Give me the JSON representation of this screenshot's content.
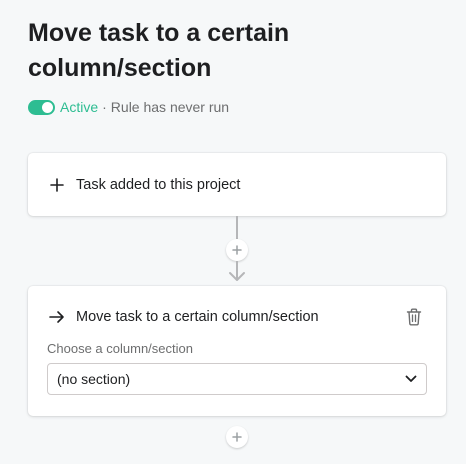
{
  "rule": {
    "title": "Move task to a certain column/section",
    "status_active_label": "Active",
    "status_separator": "·",
    "status_text": "Rule has never run",
    "toggle_on": true
  },
  "trigger": {
    "icon": "plus-icon",
    "label": "Task added to this project"
  },
  "action": {
    "icon": "arrow-right-icon",
    "label": "Move task to a certain column/section",
    "field_label": "Choose a column/section",
    "select_value": "(no section)",
    "delete_icon": "trash-icon"
  },
  "colors": {
    "accent_green": "#2ebd92",
    "text_primary": "#1e1f21",
    "text_secondary": "#6d6e6f",
    "background": "#f6f8f9"
  }
}
